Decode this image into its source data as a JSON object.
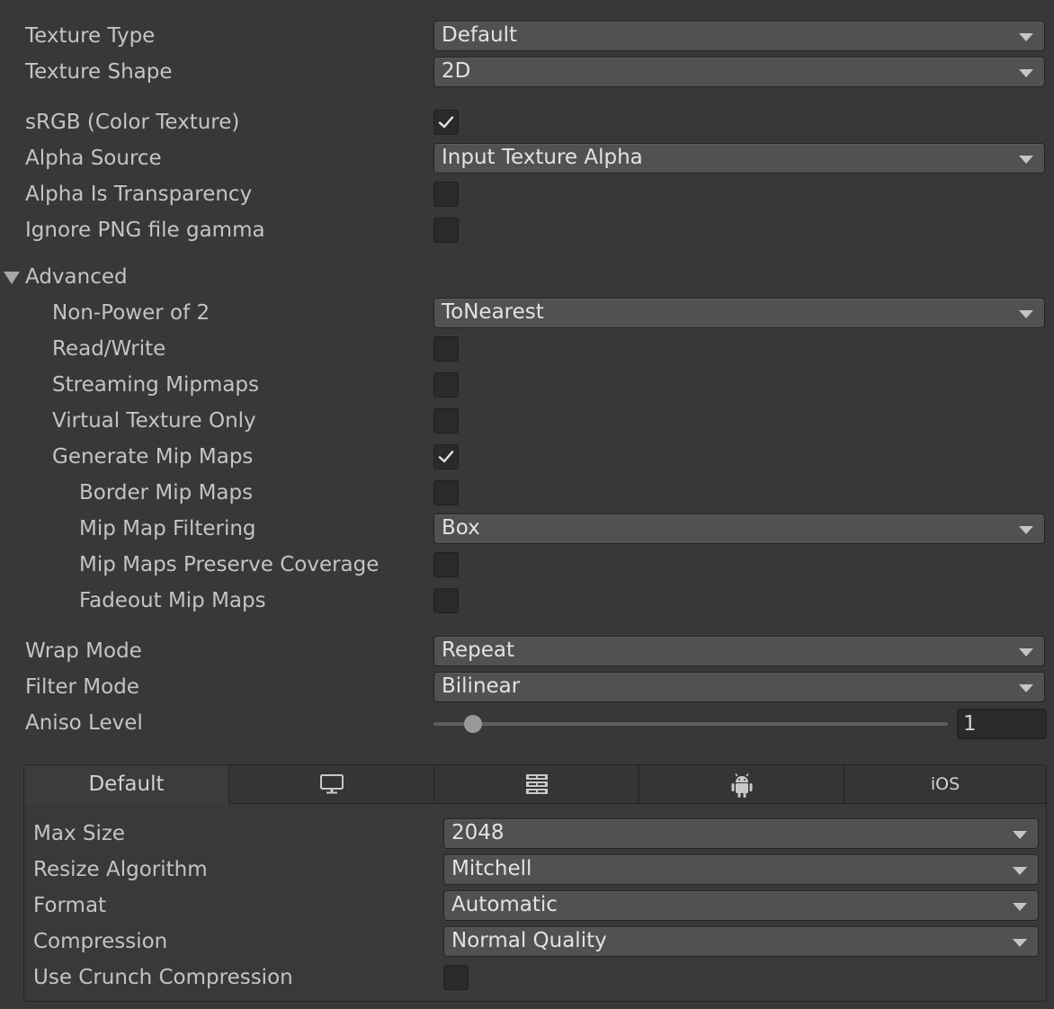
{
  "settings": {
    "texture_type": {
      "label": "Texture Type",
      "value": "Default"
    },
    "texture_shape": {
      "label": "Texture Shape",
      "value": "2D"
    },
    "srgb": {
      "label": "sRGB (Color Texture)",
      "checked": true
    },
    "alpha_source": {
      "label": "Alpha Source",
      "value": "Input Texture Alpha"
    },
    "alpha_is_transparency": {
      "label": "Alpha Is Transparency",
      "checked": false
    },
    "ignore_png_gamma": {
      "label": "Ignore PNG file gamma",
      "checked": false
    }
  },
  "advanced": {
    "label": "Advanced",
    "expanded": true,
    "non_power_of_2": {
      "label": "Non-Power of 2",
      "value": "ToNearest"
    },
    "read_write": {
      "label": "Read/Write",
      "checked": false
    },
    "streaming_mipmaps": {
      "label": "Streaming Mipmaps",
      "checked": false
    },
    "virtual_texture_only": {
      "label": "Virtual Texture Only",
      "checked": false
    },
    "generate_mip_maps": {
      "label": "Generate Mip Maps",
      "checked": true
    },
    "border_mip_maps": {
      "label": "Border Mip Maps",
      "checked": false
    },
    "mip_map_filtering": {
      "label": "Mip Map Filtering",
      "value": "Box"
    },
    "mip_maps_preserve_coverage": {
      "label": "Mip Maps Preserve Coverage",
      "checked": false
    },
    "fadeout_mip_maps": {
      "label": "Fadeout Mip Maps",
      "checked": false
    }
  },
  "sampling": {
    "wrap_mode": {
      "label": "Wrap Mode",
      "value": "Repeat"
    },
    "filter_mode": {
      "label": "Filter Mode",
      "value": "Bilinear"
    },
    "aniso_level": {
      "label": "Aniso Level",
      "value": "1",
      "min": 0,
      "max": 16
    }
  },
  "platform_tabs": [
    {
      "label": "Default",
      "icon": null,
      "active": true
    },
    {
      "label": "",
      "icon": "monitor-icon",
      "active": false
    },
    {
      "label": "",
      "icon": "server-rack-icon",
      "active": false
    },
    {
      "label": "",
      "icon": "android-icon",
      "active": false
    },
    {
      "label": "iOS",
      "icon": null,
      "active": false
    }
  ],
  "platform_settings": {
    "max_size": {
      "label": "Max Size",
      "value": "2048"
    },
    "resize_algorithm": {
      "label": "Resize Algorithm",
      "value": "Mitchell"
    },
    "format": {
      "label": "Format",
      "value": "Automatic"
    },
    "compression": {
      "label": "Compression",
      "value": "Normal Quality"
    },
    "use_crunch": {
      "label": "Use Crunch Compression",
      "checked": false
    }
  },
  "colors": {
    "background": "#383838",
    "field": "#515151",
    "checkbox": "#2a2a2a",
    "text": "#c4c4c4"
  }
}
